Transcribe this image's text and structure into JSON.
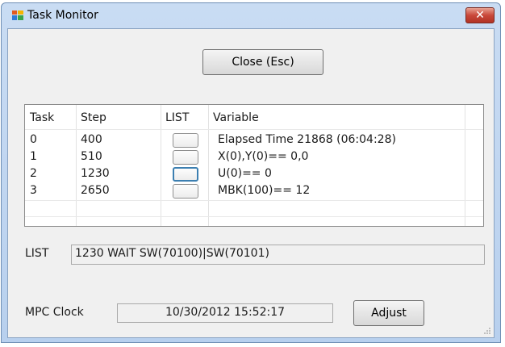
{
  "window": {
    "title": "Task Monitor",
    "close_glyph": "✕"
  },
  "toolbar": {
    "close_label": "Close (Esc)"
  },
  "table": {
    "columns": [
      "Task",
      "Step",
      "LIST",
      "Variable"
    ],
    "rows": [
      {
        "task": "0",
        "step": "400",
        "variable": "Elapsed Time 21868 (06:04:28)"
      },
      {
        "task": "1",
        "step": "510",
        "variable": "X(0),Y(0)== 0,0"
      },
      {
        "task": "2",
        "step": "1230",
        "variable": "U(0)== 0"
      },
      {
        "task": "3",
        "step": "2650",
        "variable": "MBK(100)== 12"
      }
    ],
    "focused_row": 2
  },
  "list": {
    "label": "LIST",
    "value": "1230  WAIT   SW(70100)|SW(70101)"
  },
  "clock": {
    "label": "MPC Clock",
    "value": "10/30/2012 15:52:17",
    "adjust_label": "Adjust"
  },
  "colors": {
    "accent": "#3c7fb1",
    "close_red": "#c9483a"
  },
  "icons": {
    "app": "task-monitor-app-icon",
    "close": "close-icon",
    "resize": "resize-grip-icon"
  }
}
